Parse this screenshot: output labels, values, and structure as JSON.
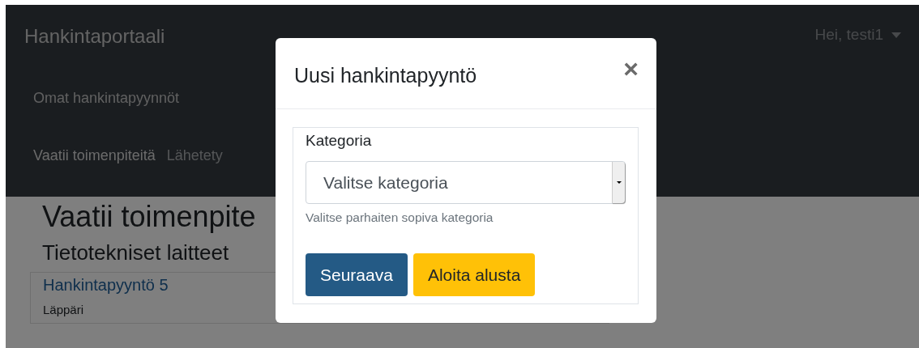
{
  "navbar": {
    "brand": "Hankintaportaali",
    "nav_links": [
      {
        "label": "Omat hankintapyynnöt"
      }
    ],
    "tabs": [
      {
        "label": "Vaatii toimenpiteitä",
        "selected": true
      },
      {
        "label": "Lähetety",
        "selected": false
      }
    ],
    "user_menu": "Hei, testi1"
  },
  "content": {
    "heading": "Vaatii toimenpite",
    "section": "Tietotekniset laitteet",
    "cards": [
      {
        "title": "Hankintapyyntö 5",
        "subtitle": "Läppäri"
      }
    ]
  },
  "modal": {
    "title": "Uusi hankintapyyntö",
    "close": "×",
    "field": {
      "label": "Kategoria",
      "value": "Valitse kategoria",
      "hint": "Valitse parhaiten sopiva kategoria"
    },
    "buttons": [
      {
        "label": "Seuraava",
        "kind": "primary"
      },
      {
        "label": "Aloita alusta",
        "kind": "warning"
      }
    ]
  }
}
